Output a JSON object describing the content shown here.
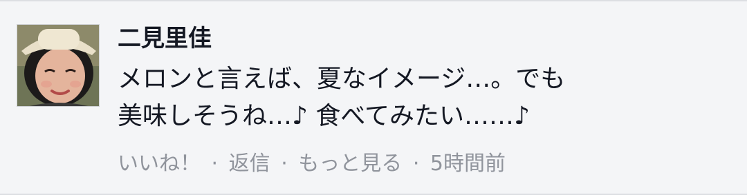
{
  "comment": {
    "author": "二見里佳",
    "text_lines": [
      "メロンと言えば、夏なイメージ…。でも",
      "美味しそうね…♪ 食べてみたい……♪"
    ],
    "actions": {
      "like": "いいね！",
      "reply": "返信",
      "more": "もっと見る",
      "separator": "·",
      "time": "5時間前"
    }
  },
  "colors": {
    "background": "#f4f5f7",
    "text": "#141823",
    "meta": "#90949c"
  },
  "icons": {
    "avatar": "profile-photo"
  }
}
